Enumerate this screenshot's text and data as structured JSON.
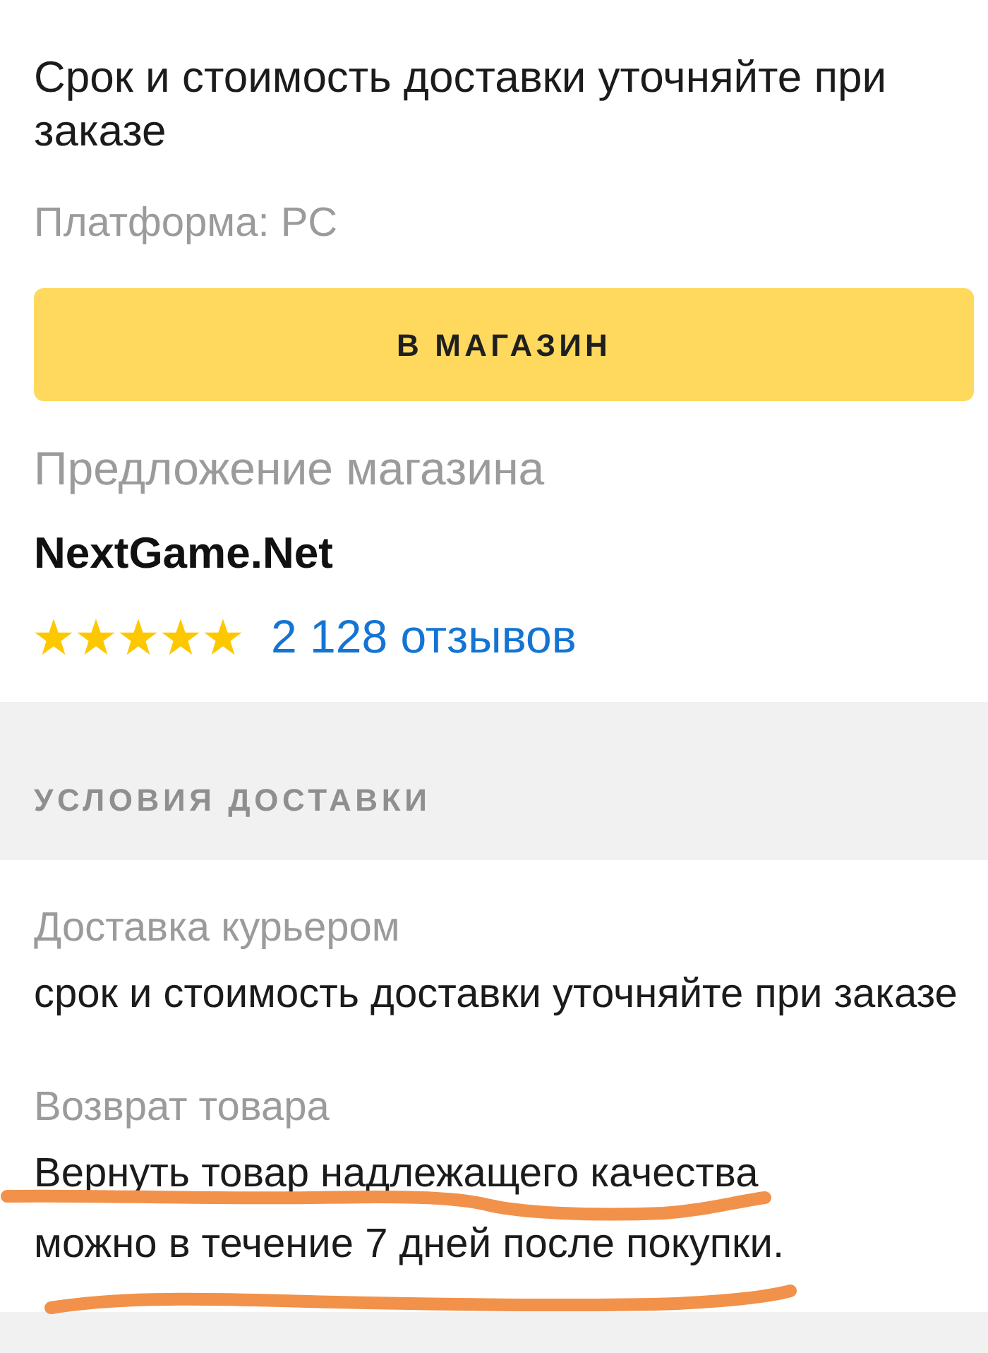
{
  "delivery_note": "Срок и стоимость доставки уточняйте при заказе",
  "platform": "Платформа: PC",
  "shop_button": "В МАГАЗИН",
  "offer": {
    "label": "Предложение магазина",
    "store_name": "NextGame.Net",
    "stars": 5,
    "reviews": "2 128 отзывов"
  },
  "delivery_conditions": {
    "heading": "УСЛОВИЯ ДОСТАВКИ",
    "items": [
      {
        "label": "Доставка курьером",
        "text": "срок и стоимость доставки уточняйте при заказе",
        "marker_underlined": false
      },
      {
        "label": "Возврат товара",
        "text": "Вернуть товар надлежащего качества\nможно в течение 7 дней после покупки.",
        "marker_underlined": true
      }
    ]
  }
}
